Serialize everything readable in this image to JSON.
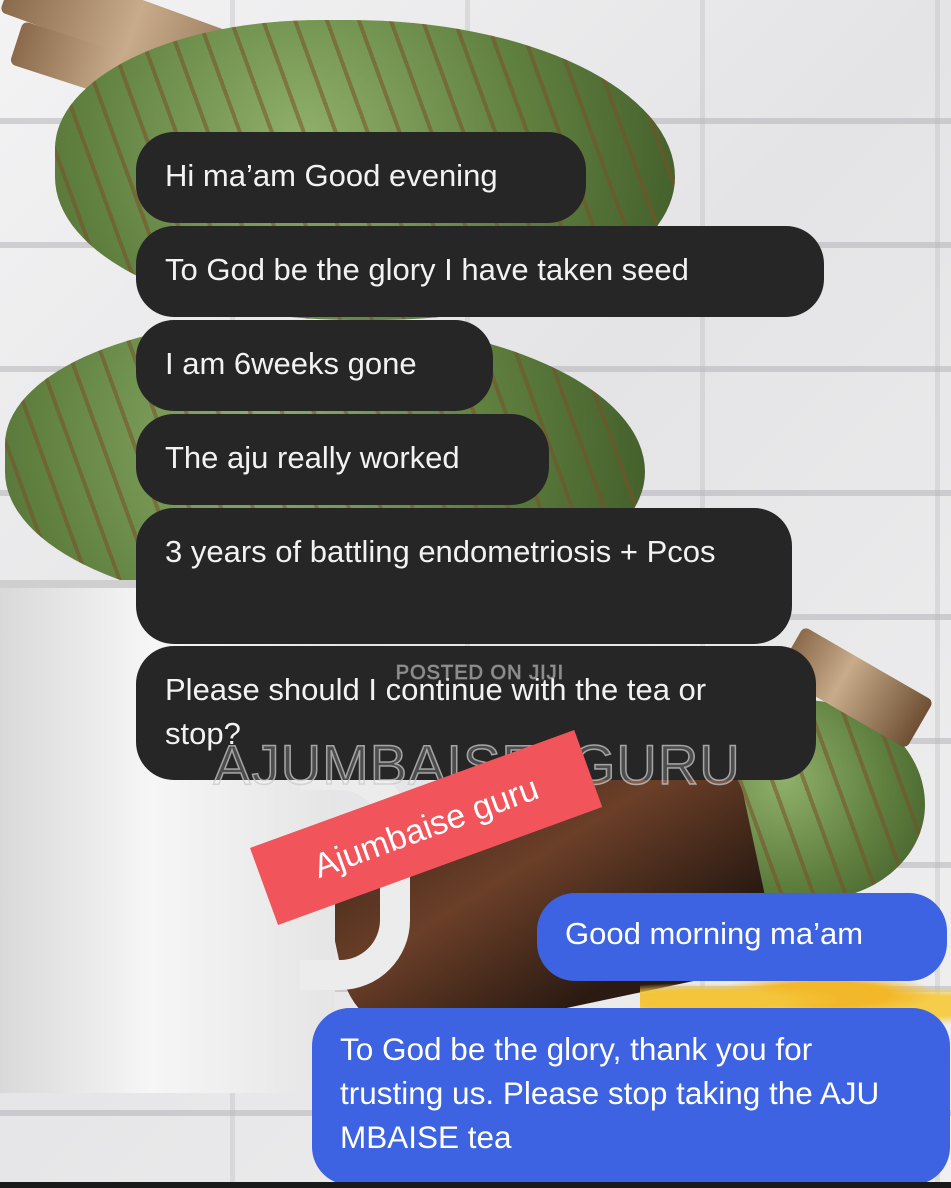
{
  "messages": [
    {
      "sender": "them",
      "text": "Hi ma’am Good evening"
    },
    {
      "sender": "them",
      "text": "To God be the glory I have taken seed"
    },
    {
      "sender": "them",
      "text": "I am 6weeks gone"
    },
    {
      "sender": "them",
      "text": "The aju really worked"
    },
    {
      "sender": "them",
      "text": "3 years of battling endometriosis + Pcos"
    },
    {
      "sender": "them",
      "text": "Please should I continue with the tea or stop?"
    },
    {
      "sender": "me",
      "text": "Good morning ma’am"
    },
    {
      "sender": "me",
      "text": "To God be the glory, thank you for trusting us. Please stop taking the AJU MBAISE tea"
    }
  ],
  "watermark": {
    "small": "POSTED ON JIJI",
    "large": "AJUMBAISE_GURU"
  },
  "sticker": {
    "text": "Ajumbaise guru"
  },
  "colors": {
    "incoming_bubble": "#262626",
    "outgoing_bubble": "#3d63e2",
    "sticker": "#f1545a"
  }
}
